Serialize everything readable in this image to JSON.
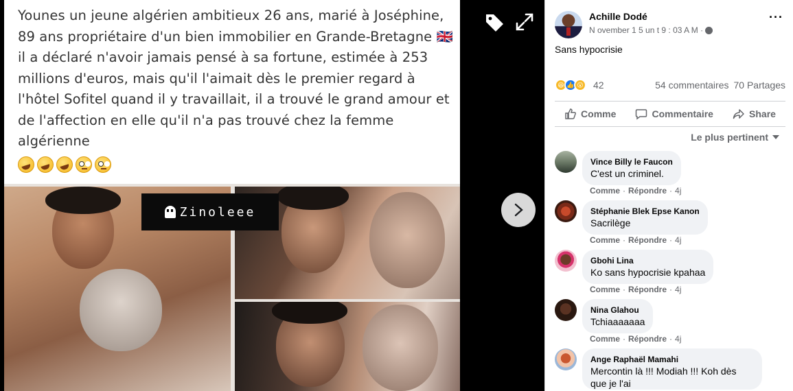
{
  "media": {
    "caption": "Younes un jeune algérien ambitieux 26 ans, marié à Joséphine, 89 ans propriétaire d'un bien immobilier en Grande-Bretagne 🇬🇧 il a déclaré n'avoir jamais pensé à sa fortune, estimée à 253 millions d'euros, mais qu'il l'aimait dès le premier regard à l'hôtel Sofitel quand il y travaillait, il a trouvé le grand amour et de l'affection en elle qu'il n'a pas trouvé chez la femme algérienne",
    "watermark": "Zinoleee",
    "icons": [
      "tag-icon",
      "expand-icon",
      "chevron-right-icon"
    ]
  },
  "post": {
    "author": "Achille Dodé",
    "timestamp": "N ovember 1 5 un t 9 : 03 A M ·",
    "text": "Sans hypocrisie",
    "reaction_count": "42",
    "comments_count": "54 commentaires",
    "shares_count": "70 Partages"
  },
  "actions": {
    "like": "Comme",
    "comment": "Commentaire",
    "share": "Share"
  },
  "sort_label": "Le plus pertinent",
  "comments": [
    {
      "name": "Vince Billy le Faucon",
      "text": "C'est un criminel.",
      "like": "Comme",
      "reply": "Répondre",
      "time": "4j"
    },
    {
      "name": "Stéphanie Blek Epse Kanon",
      "text": "Sacrilège",
      "like": "Comme",
      "reply": "Répondre",
      "time": "4j"
    },
    {
      "name": "Gbohi Lina",
      "text": "Ko sans hypocrisie kpahaa",
      "like": "Comme",
      "reply": "Répondre",
      "time": "4j"
    },
    {
      "name": "Nina Glahou",
      "text": "Tchiaaaaaaa",
      "like": "Comme",
      "reply": "Répondre",
      "time": "4j"
    },
    {
      "name": "Ange Raphaël Mamahi",
      "text": "Mercontin là !!! Modiah !!! Koh dès que je l'ai"
    }
  ],
  "colors": {
    "accent": "#1877f2",
    "secondary_text": "#65676b",
    "bubble": "#f0f2f5"
  }
}
